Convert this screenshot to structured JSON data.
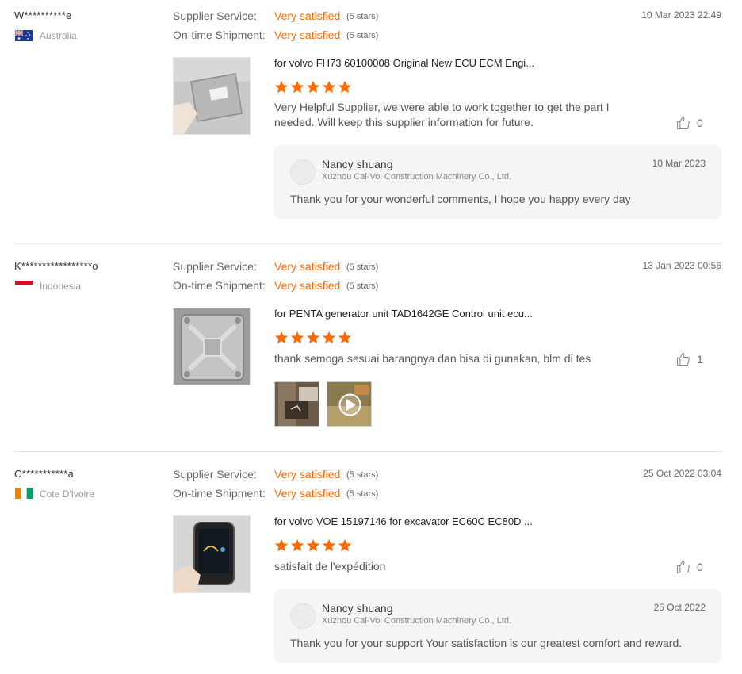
{
  "labels": {
    "supplier_service": "Supplier Service:",
    "ontime_shipment": "On-time Shipment:"
  },
  "colors": {
    "accent": "#ff6a00",
    "reply_bg": "#f5f5f6",
    "divider": "#e3e3e3"
  },
  "reviews": [
    {
      "buyer": "W**********e",
      "country": "Australia",
      "flag_icon": "australia-flag-icon",
      "date": "10 Mar 2023 22:49",
      "supplier_service": {
        "value": "Very satisfied",
        "stars_text": "(5 stars)"
      },
      "ontime_shipment": {
        "value": "Very satisfied",
        "stars_text": "(5 stars)"
      },
      "product_title": "for volvo FH73 60100008 Original New ECU ECM Engi...",
      "rating": 5,
      "comment": "Very Helpful Supplier, we were able to work together to get the part I needed. Will keep this supplier information for future.",
      "likes": "0",
      "reply": {
        "name": "Nancy shuang",
        "company": "Xuzhou Cal-Vol Construction Machinery Co., Ltd.",
        "date": "10 Mar 2023",
        "text": "Thank you for your wonderful comments, I hope you happy every day"
      }
    },
    {
      "buyer": "K*****************o",
      "country": "Indonesia",
      "flag_icon": "indonesia-flag-icon",
      "date": "13 Jan 2023 00:56",
      "supplier_service": {
        "value": "Very satisfied",
        "stars_text": "(5 stars)"
      },
      "ontime_shipment": {
        "value": "Very satisfied",
        "stars_text": "(5 stars)"
      },
      "product_title": "for PENTA generator unit TAD1642GE Control unit ecu...",
      "rating": 5,
      "comment": "thank semoga sesuai barangnya dan bisa di gunakan, blm di tes",
      "likes": "1",
      "media": [
        "photo-thumbnail",
        "video-thumbnail"
      ]
    },
    {
      "buyer": "C***********a",
      "country": "Cote D'Ivoire",
      "flag_icon": "cote-divoire-flag-icon",
      "date": "25 Oct 2022 03:04",
      "supplier_service": {
        "value": "Very satisfied",
        "stars_text": "(5 stars)"
      },
      "ontime_shipment": {
        "value": "Very satisfied",
        "stars_text": "(5 stars)"
      },
      "product_title": "for volvo VOE 15197146 for excavator EC60C EC80D ...",
      "rating": 5,
      "comment": "satisfait de l'expédition",
      "likes": "0",
      "reply": {
        "name": "Nancy shuang",
        "company": "Xuzhou Cal-Vol Construction Machinery Co., Ltd.",
        "date": "25 Oct 2022",
        "text": "Thank you for your support Your satisfaction is our greatest comfort and reward."
      }
    }
  ]
}
